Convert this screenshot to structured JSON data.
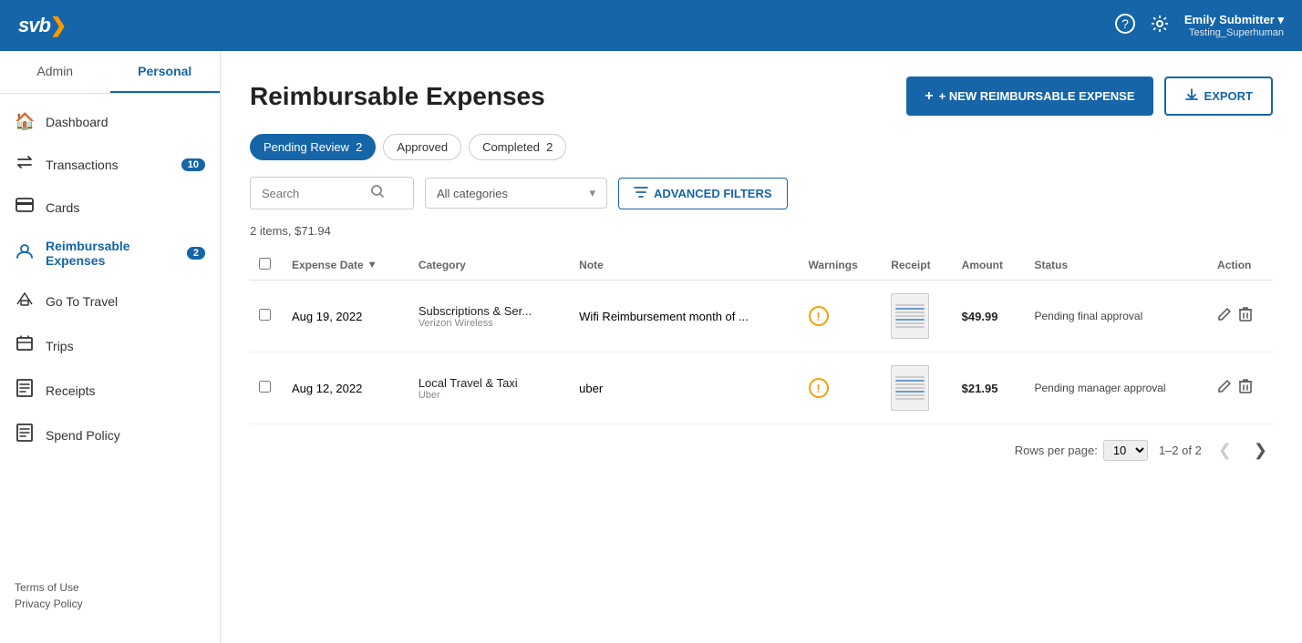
{
  "topnav": {
    "logo": "svb>",
    "help_icon": "?",
    "settings_icon": "⚙",
    "username": "Emily Submitter ▾",
    "subname": "Testing_Superhuman"
  },
  "sidebar": {
    "tab_admin": "Admin",
    "tab_personal": "Personal",
    "active_tab": "Personal",
    "items": [
      {
        "id": "dashboard",
        "label": "Dashboard",
        "icon": "🏠",
        "badge": null
      },
      {
        "id": "transactions",
        "label": "Transactions",
        "icon": "↔",
        "badge": "10"
      },
      {
        "id": "cards",
        "label": "Cards",
        "icon": "💳",
        "badge": null
      },
      {
        "id": "reimbursable-expenses",
        "label": "Reimbursable Expenses",
        "icon": "👤",
        "badge": "2",
        "active": true
      },
      {
        "id": "go-to-travel",
        "label": "Go To Travel",
        "icon": "✈",
        "badge": null
      },
      {
        "id": "trips",
        "label": "Trips",
        "icon": "📋",
        "badge": null
      },
      {
        "id": "receipts",
        "label": "Receipts",
        "icon": "🧾",
        "badge": null
      },
      {
        "id": "spend-policy",
        "label": "Spend Policy",
        "icon": "📄",
        "badge": null
      }
    ],
    "footer_links": [
      "Terms of Use",
      "Privacy Policy"
    ]
  },
  "page": {
    "title": "Reimbursable Expenses",
    "new_button": "+ NEW REIMBURSABLE EXPENSE",
    "export_button": "EXPORT",
    "filter_tabs": [
      {
        "label": "Pending Review",
        "count": "2",
        "active": true
      },
      {
        "label": "Approved",
        "count": null,
        "active": false
      },
      {
        "label": "Completed",
        "count": "2",
        "active": false
      }
    ],
    "search_placeholder": "Search",
    "category_placeholder": "All categories",
    "adv_filters_label": "ADVANCED FILTERS",
    "summary": "2 items, $71.94",
    "table": {
      "columns": [
        "",
        "Expense Date",
        "Category",
        "Note",
        "Warnings",
        "Receipt",
        "Amount",
        "Status",
        "Action"
      ],
      "rows": [
        {
          "id": 1,
          "date": "Aug 19, 2022",
          "category_main": "Subscriptions & Ser...",
          "category_sub": "Verizon Wireless",
          "note": "Wifi Reimbursement month of ...",
          "has_warning": true,
          "amount": "$49.99",
          "status": "Pending final approval"
        },
        {
          "id": 2,
          "date": "Aug 12, 2022",
          "category_main": "Local Travel & Taxi",
          "category_sub": "Uber",
          "note": "uber",
          "has_warning": true,
          "amount": "$21.95",
          "status": "Pending manager approval"
        }
      ]
    },
    "pagination": {
      "rows_per_page_label": "Rows per page:",
      "rows_per_page": "10",
      "page_info": "1–2 of 2"
    }
  }
}
